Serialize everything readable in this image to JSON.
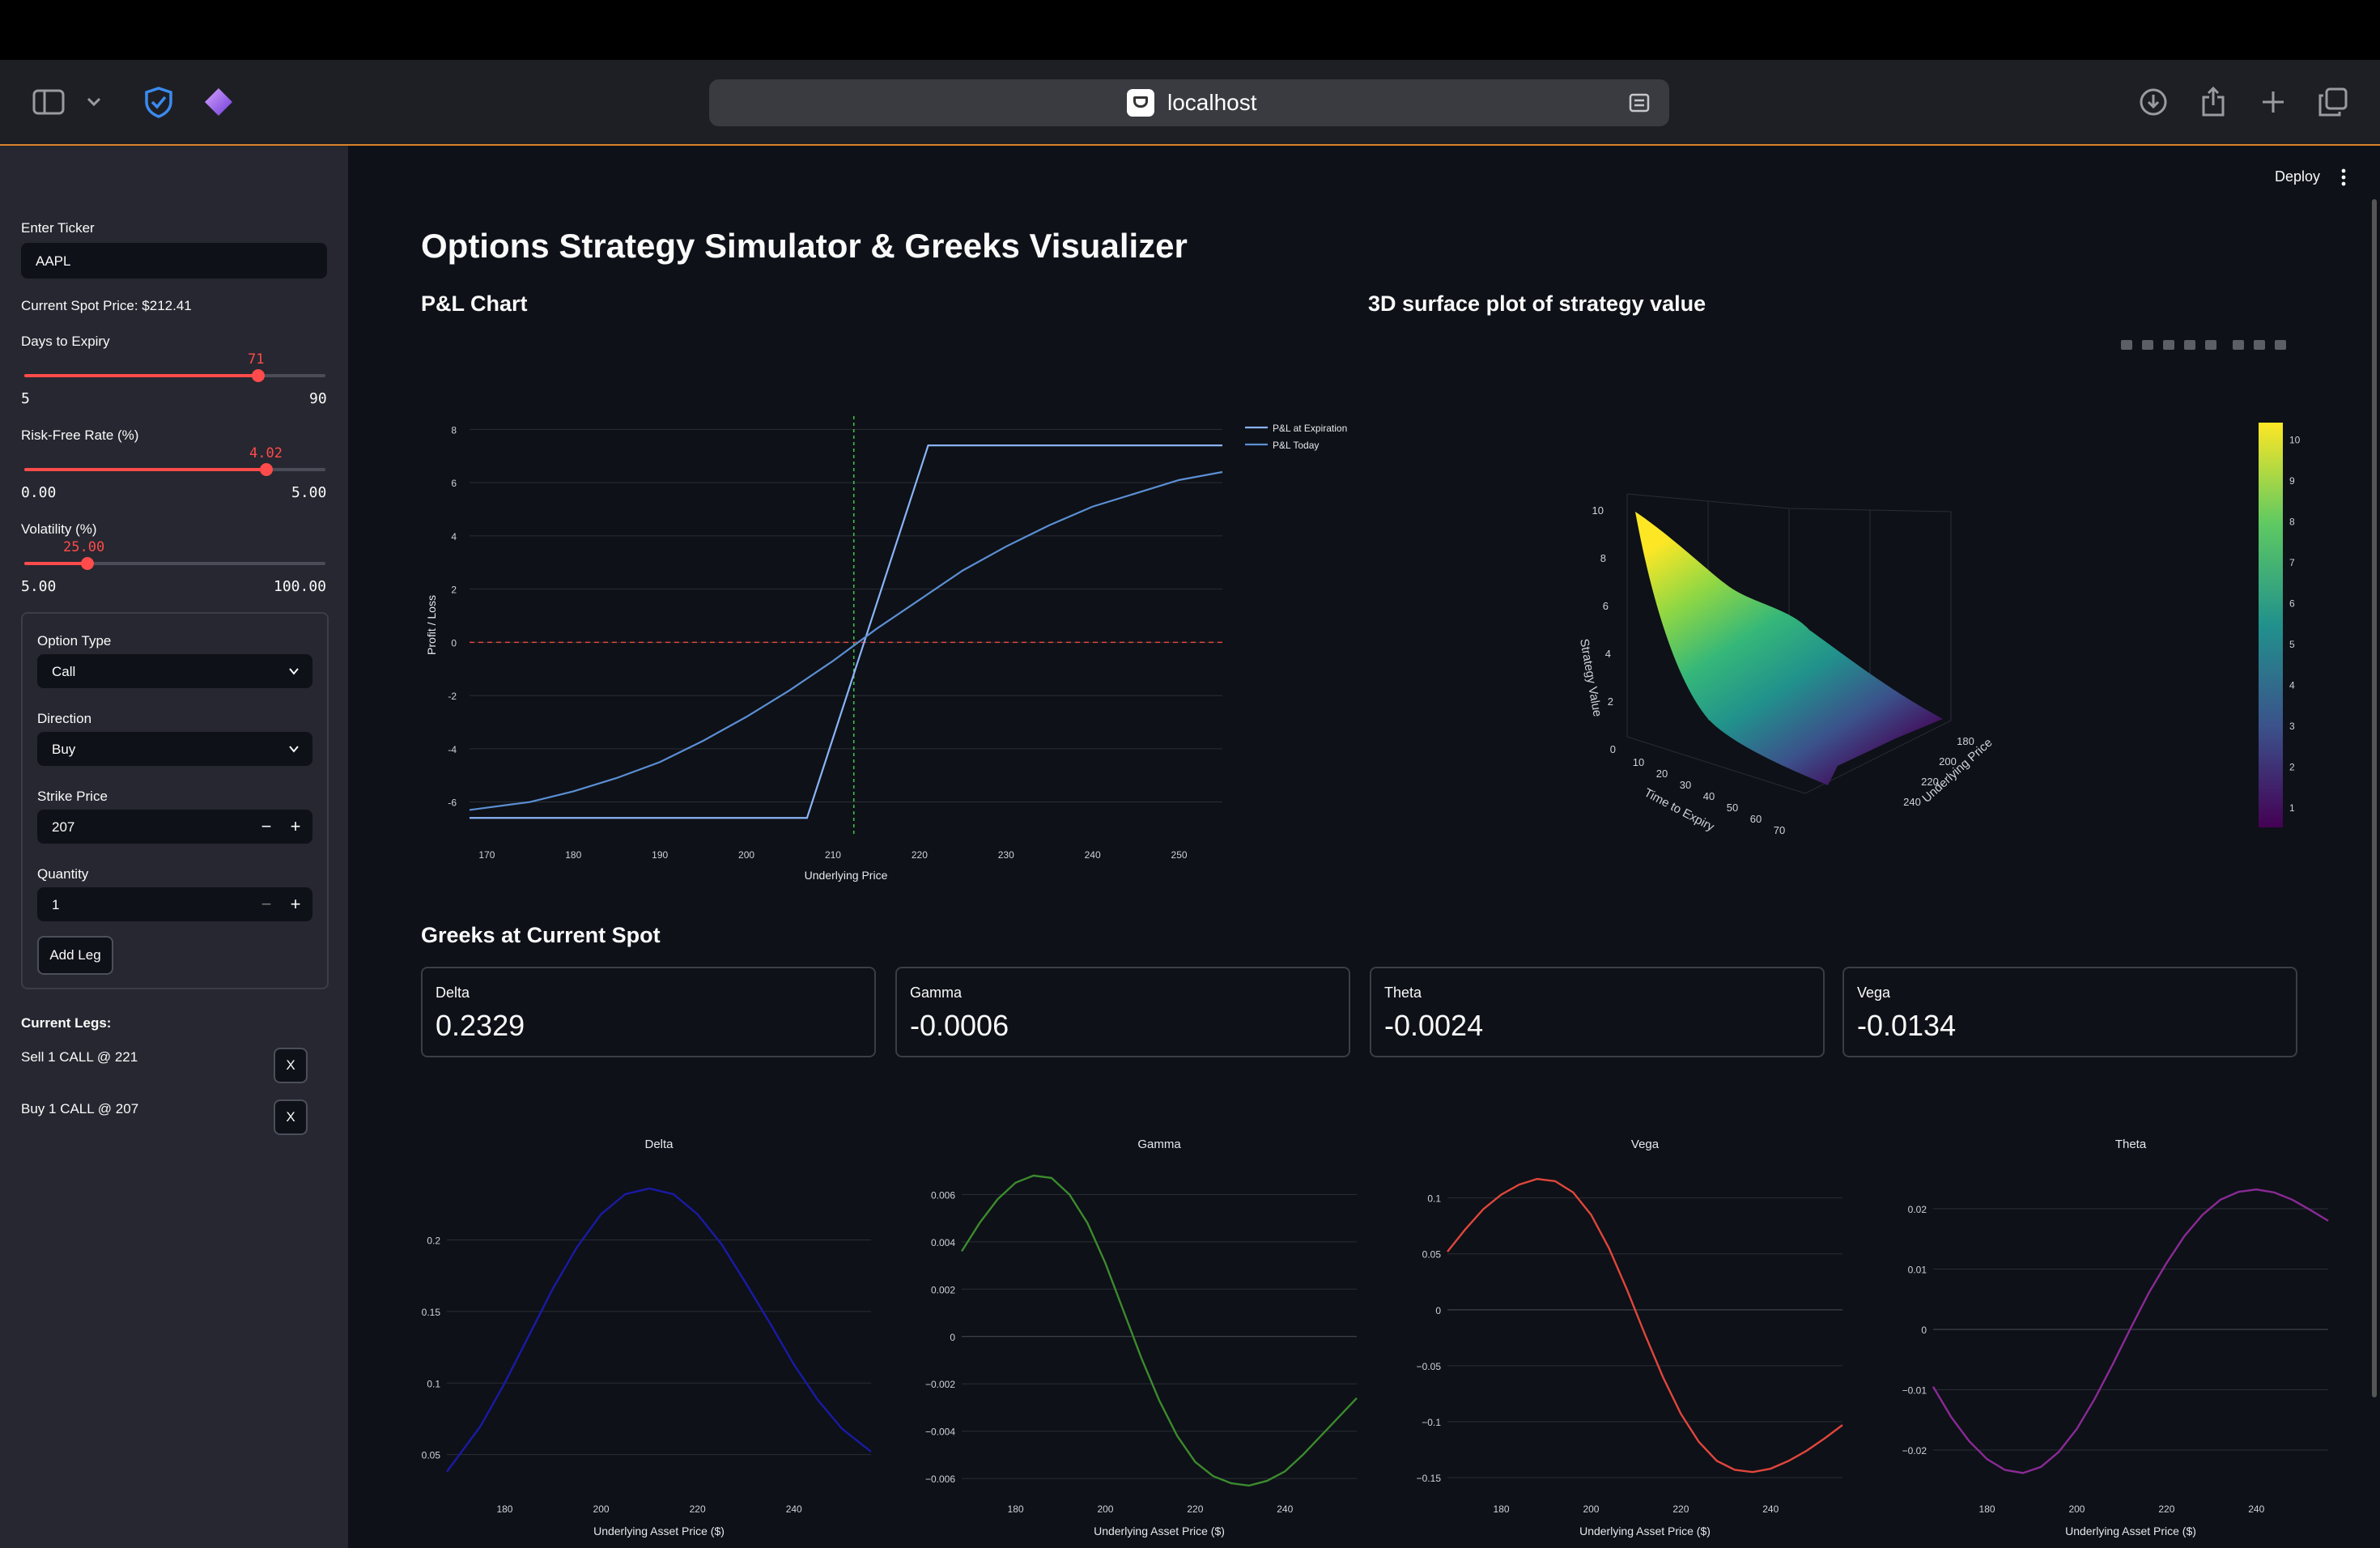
{
  "browser": {
    "url": "localhost"
  },
  "app": {
    "title": "Options Strategy Simulator & Greeks Visualizer",
    "deploy_label": "Deploy"
  },
  "sidebar": {
    "ticker_label": "Enter Ticker",
    "ticker_value": "AAPL",
    "spot_text": "Current Spot Price: $212.41",
    "days": {
      "label": "Days to Expiry",
      "value": 71,
      "min": 5,
      "max": 90,
      "value_text": "71",
      "min_text": "5",
      "max_text": "90"
    },
    "rate": {
      "label": "Risk-Free Rate (%)",
      "value": 4.02,
      "min": 0,
      "max": 5,
      "value_text": "4.02",
      "min_text": "0.00",
      "max_text": "5.00"
    },
    "vol": {
      "label": "Volatility (%)",
      "value": 25,
      "min": 5,
      "max": 100,
      "value_text": "25.00",
      "min_text": "5.00",
      "max_text": "100.00"
    },
    "form": {
      "option_type_label": "Option Type",
      "option_type_value": "Call",
      "direction_label": "Direction",
      "direction_value": "Buy",
      "strike_label": "Strike Price",
      "strike_value": "207",
      "quantity_label": "Quantity",
      "quantity_value": "1",
      "add_leg_label": "Add Leg"
    },
    "legs_title": "Current Legs:",
    "legs": [
      {
        "text": "Sell 1 CALL @ 221",
        "remove": "X"
      },
      {
        "text": "Buy 1 CALL @ 207",
        "remove": "X"
      }
    ]
  },
  "sections": {
    "pnl": "P&L Chart",
    "surface": "3D surface plot of strategy value",
    "greeks": "Greeks at Current Spot"
  },
  "metrics": [
    {
      "label": "Delta",
      "value": "0.2329"
    },
    {
      "label": "Gamma",
      "value": "-0.0006"
    },
    {
      "label": "Theta",
      "value": "-0.0024"
    },
    {
      "label": "Vega",
      "value": "-0.0134"
    }
  ],
  "chart_data": [
    {
      "type": "line",
      "xlabel": "Underlying Price",
      "ylabel": "Profit / Loss",
      "xlim": [
        168,
        255
      ],
      "ylim": [
        -7.2,
        8.5
      ],
      "xticks": [
        170,
        180,
        190,
        200,
        210,
        220,
        230,
        240,
        250
      ],
      "yticks": [
        -6,
        -4,
        -2,
        0,
        2,
        4,
        6,
        8
      ],
      "legend_position": "top-right",
      "spot_marker_x": 212.41,
      "zero_line_y": 0,
      "series": [
        {
          "name": "P&L at Expiration",
          "color": "#8ab4f8",
          "x": [
            168,
            207,
            221,
            255
          ],
          "y": [
            -6.6,
            -6.6,
            7.4,
            7.4
          ]
        },
        {
          "name": "P&L Today",
          "color": "#5b8fd4",
          "x": [
            168,
            175,
            180,
            185,
            190,
            195,
            200,
            205,
            210,
            215,
            220,
            225,
            230,
            235,
            240,
            245,
            250,
            255
          ],
          "y": [
            -6.3,
            -6.0,
            -5.6,
            -5.1,
            -4.5,
            -3.7,
            -2.8,
            -1.8,
            -0.7,
            0.5,
            1.6,
            2.7,
            3.6,
            4.4,
            5.1,
            5.6,
            6.1,
            6.4
          ]
        }
      ]
    },
    {
      "type": "surface",
      "xlabel": "Time to Expiry",
      "ylabel": "Underlying Price",
      "zlabel": "Strategy Value",
      "xticks": [
        "10",
        "20",
        "30",
        "40",
        "50",
        "60",
        "70"
      ],
      "yticks": [
        "180",
        "200",
        "220",
        "240"
      ],
      "zticks": [
        "0",
        "2",
        "4",
        "6",
        "8",
        "10"
      ],
      "colorbar_ticks": [
        "1",
        "2",
        "3",
        "4",
        "5",
        "6",
        "7",
        "8",
        "9",
        "10"
      ],
      "colorscale": [
        "#440154",
        "#3b528b",
        "#21918c",
        "#5ec962",
        "#fde725"
      ],
      "modebar": [
        "camera-icon",
        "zoom-icon",
        "pan-icon",
        "orbit-icon",
        "turntable-icon",
        "home-icon",
        "reset-camera-icon",
        "fullscreen-icon"
      ]
    },
    {
      "type": "line",
      "title": "Delta",
      "xlabel": "Underlying Asset Price ($)",
      "color": "#1a1aa6",
      "xlim": [
        168,
        256
      ],
      "ylim": [
        0.03,
        0.245
      ],
      "xticks": [
        180,
        200,
        220,
        240
      ],
      "yticks": [
        0.05,
        0.1,
        0.15,
        0.2
      ],
      "ytick_labels": [
        "0.05",
        "0.1",
        "0.15",
        "0.2"
      ],
      "x": [
        168,
        175,
        180,
        185,
        190,
        195,
        200,
        205,
        210,
        215,
        220,
        225,
        230,
        235,
        240,
        245,
        250,
        256
      ],
      "y": [
        0.038,
        0.07,
        0.1,
        0.133,
        0.166,
        0.195,
        0.218,
        0.232,
        0.236,
        0.232,
        0.218,
        0.197,
        0.17,
        0.142,
        0.113,
        0.088,
        0.068,
        0.052
      ]
    },
    {
      "type": "line",
      "title": "Gamma",
      "xlabel": "Underlying Asset Price ($)",
      "color": "#3c8a2e",
      "xlim": [
        168,
        256
      ],
      "ylim": [
        -0.0062,
        0.0068
      ],
      "xticks": [
        180,
        200,
        220,
        240
      ],
      "yticks": [
        -0.006,
        -0.004,
        -0.002,
        0,
        0.002,
        0.004,
        0.006
      ],
      "ytick_labels": [
        "−0.006",
        "−0.004",
        "−0.002",
        "0",
        "0.002",
        "0.004",
        "0.006"
      ],
      "x": [
        168,
        172,
        176,
        180,
        184,
        188,
        192,
        196,
        200,
        204,
        208,
        212,
        216,
        220,
        224,
        228,
        232,
        236,
        240,
        244,
        248,
        252,
        256
      ],
      "y": [
        0.0036,
        0.0048,
        0.0058,
        0.0065,
        0.0068,
        0.0067,
        0.006,
        0.0048,
        0.0031,
        0.0011,
        -0.0009,
        -0.0027,
        -0.0042,
        -0.0053,
        -0.0059,
        -0.0062,
        -0.0063,
        -0.0061,
        -0.0057,
        -0.005,
        -0.0042,
        -0.0034,
        -0.0026
      ]
    },
    {
      "type": "line",
      "title": "Vega",
      "xlabel": "Underlying Asset Price ($)",
      "color": "#e0463c",
      "xlim": [
        168,
        256
      ],
      "ylim": [
        -0.155,
        0.12
      ],
      "xticks": [
        180,
        200,
        220,
        240
      ],
      "yticks": [
        -0.15,
        -0.1,
        -0.05,
        0,
        0.05,
        0.1
      ],
      "ytick_labels": [
        "−0.15",
        "−0.1",
        "−0.05",
        "0",
        "0.05",
        "0.1"
      ],
      "x": [
        168,
        172,
        176,
        180,
        184,
        188,
        192,
        196,
        200,
        204,
        208,
        212,
        216,
        220,
        224,
        228,
        232,
        236,
        240,
        244,
        248,
        252,
        256
      ],
      "y": [
        0.052,
        0.072,
        0.09,
        0.103,
        0.112,
        0.117,
        0.115,
        0.105,
        0.085,
        0.055,
        0.018,
        -0.022,
        -0.06,
        -0.093,
        -0.118,
        -0.135,
        -0.143,
        -0.145,
        -0.142,
        -0.135,
        -0.126,
        -0.115,
        -0.103
      ]
    },
    {
      "type": "line",
      "title": "Theta",
      "xlabel": "Underlying Asset Price ($)",
      "color": "#8a2a96",
      "xlim": [
        168,
        256
      ],
      "ylim": [
        -0.0255,
        0.0255
      ],
      "xticks": [
        180,
        200,
        220,
        240
      ],
      "yticks": [
        -0.02,
        -0.01,
        0,
        0.01,
        0.02
      ],
      "ytick_labels": [
        "−0.02",
        "−0.01",
        "0",
        "0.01",
        "0.02"
      ],
      "x": [
        168,
        172,
        176,
        180,
        184,
        188,
        192,
        196,
        200,
        204,
        208,
        212,
        216,
        220,
        224,
        228,
        232,
        236,
        240,
        244,
        248,
        252,
        256
      ],
      "y": [
        -0.0095,
        -0.0145,
        -0.0185,
        -0.0215,
        -0.0233,
        -0.0238,
        -0.0228,
        -0.0203,
        -0.0165,
        -0.0115,
        -0.0058,
        0.0002,
        0.006,
        0.011,
        0.0155,
        0.019,
        0.0215,
        0.0228,
        0.0232,
        0.0227,
        0.0215,
        0.0198,
        0.018
      ]
    }
  ]
}
